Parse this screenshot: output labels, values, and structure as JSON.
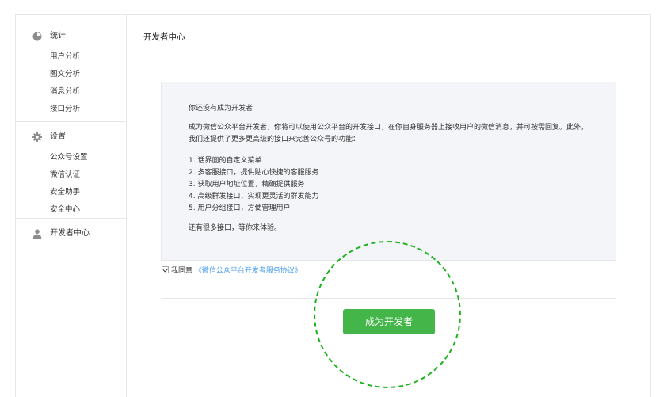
{
  "sidebar": {
    "groups": [
      {
        "title": "统计",
        "icon": "pie-chart-icon",
        "items": [
          "用户分析",
          "图文分析",
          "消息分析",
          "接口分析"
        ]
      },
      {
        "title": "设置",
        "icon": "gear-icon",
        "items": [
          "公众号设置",
          "微信认证",
          "安全助手",
          "安全中心"
        ]
      },
      {
        "title": "开发者中心",
        "icon": "person-icon",
        "items": []
      }
    ]
  },
  "main": {
    "title": "开发者中心",
    "info": {
      "heading": "你还没有成为开发者",
      "intro": "成为微信公众平台开发者，你将可以使用公众平台的开发接口，在你自身服务器上接收用户的微信消息，并可按需回复。此外，我们还提供了更多更高级的接口来完善公众号的功能：",
      "features": [
        "1. 话界面的自定义菜单",
        "2. 多客服接口，提供贴心快捷的客服服务",
        "3. 获取用户地址位置，精确提供服务",
        "4. 高级群发接口，实现更灵活的群发能力",
        "5. 用户分组接口，方便管理用户"
      ],
      "outro": "还有很多接口，等你来体验。"
    },
    "agreement": {
      "checked": true,
      "label": "我同意",
      "link_text": "《微信公众平台开发者服务协议》"
    },
    "cta_label": "成为开发者"
  },
  "colors": {
    "accent_green": "#44b549",
    "highlight_green": "#1db31d",
    "link_blue": "#459ae9",
    "border": "#e7e7eb",
    "box_bg": "#f4f5f9"
  }
}
